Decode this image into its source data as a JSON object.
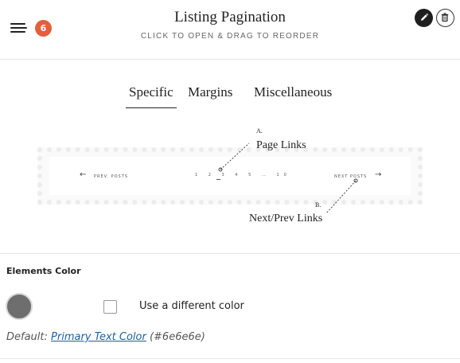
{
  "header": {
    "badge_count": "6",
    "title": "Listing Pagination",
    "subtitle": "CLICK TO OPEN & DRAG TO REORDER",
    "icons": [
      "menu-icon",
      "pencil-icon",
      "trash-icon"
    ]
  },
  "tabs": [
    {
      "label": "Specific",
      "active": true
    },
    {
      "label": "Margins",
      "active": false
    },
    {
      "label": "Miscellaneous",
      "active": false
    }
  ],
  "diagram": {
    "prev_arrow": "←",
    "prev_text": "PREV. POSTS",
    "pages": "1 2 3 4 5 … 10",
    "next_text": "NEXT POSTS",
    "next_arrow": "→",
    "annotation_a_letter": "A.",
    "annotation_a_label": "Page Links",
    "annotation_b_letter": "B.",
    "annotation_b_label": "Next/Prev Links"
  },
  "elements_color": {
    "label": "Elements Color",
    "swatch_color": "#6e6e6e",
    "checkbox_label": "Use a different color",
    "checkbox_checked": false,
    "default_prefix": "Default:",
    "default_link": "Primary Text Color",
    "default_value": "(#6e6e6e)"
  },
  "colors": {
    "badge": "#e2603b",
    "link": "#1e5e9e"
  }
}
